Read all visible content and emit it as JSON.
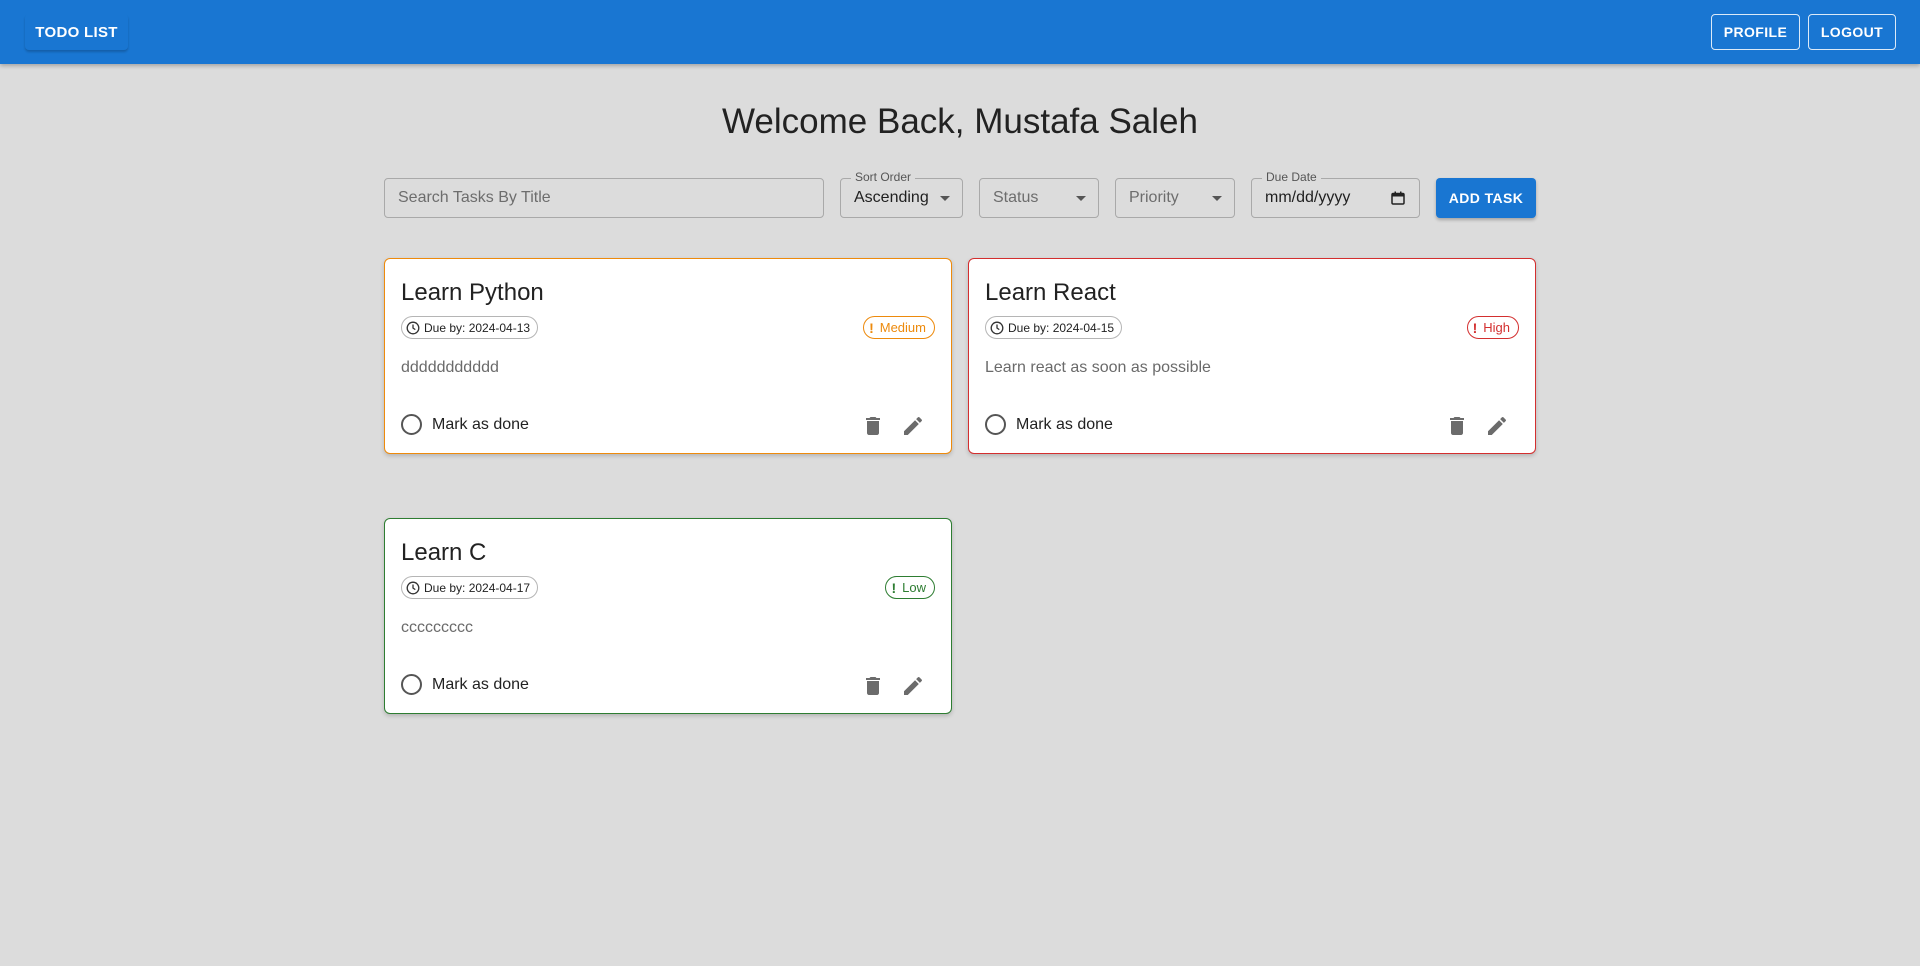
{
  "appbar": {
    "brand": "TODO LIST",
    "profile_label": "PROFILE",
    "logout_label": "LOGOUT",
    "color": "#1976d2"
  },
  "welcome": "Welcome Back, Mustafa Saleh",
  "filters": {
    "search_placeholder": "Search Tasks By Title",
    "sort_label": "Sort Order",
    "sort_value": "Ascending",
    "status_placeholder": "Status",
    "priority_placeholder": "Priority",
    "due_label": "Due Date",
    "due_placeholder": "mm/dd/yyyy",
    "add_label": "ADD TASK"
  },
  "tasks": [
    {
      "title": "Learn Python",
      "due": "Due by: 2024-04-13",
      "priority": "Medium",
      "priority_color": "#ed8a0c",
      "description": "ddddddddddd",
      "done_label": "Mark as done"
    },
    {
      "title": "Learn React",
      "due": "Due by: 2024-04-15",
      "priority": "High",
      "priority_color": "#d32f2f",
      "description": "Learn react as soon as possible",
      "done_label": "Mark as done"
    },
    {
      "title": "Learn C",
      "due": "Due by: 2024-04-17",
      "priority": "Low",
      "priority_color": "#2e7d32",
      "description": "ccccccccc",
      "done_label": "Mark as done"
    }
  ]
}
